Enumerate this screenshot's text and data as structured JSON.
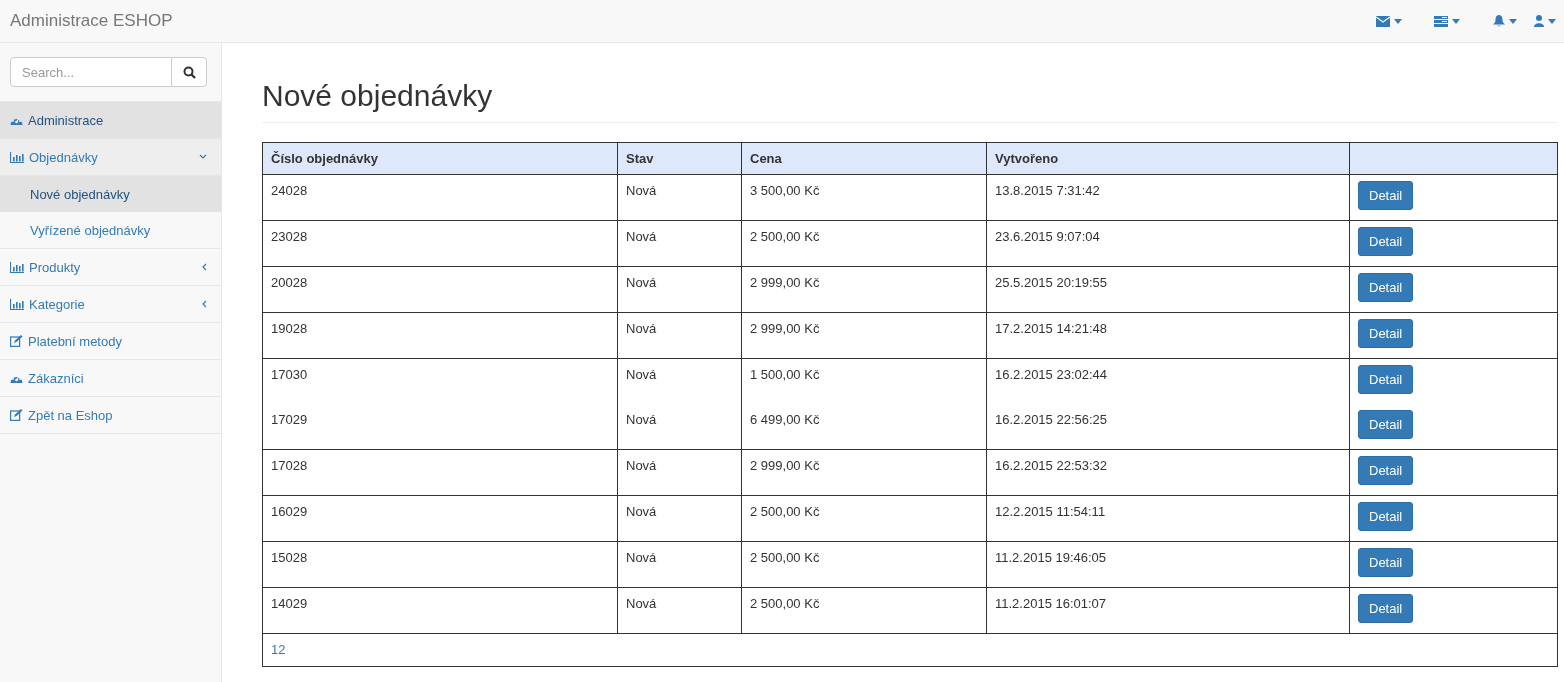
{
  "navbar": {
    "brand": "Administrace ESHOP",
    "icons": [
      {
        "kind": "envelope"
      },
      {
        "kind": "tasks"
      },
      {
        "kind": "bell"
      },
      {
        "kind": "user"
      }
    ]
  },
  "sidebar": {
    "search": {
      "placeholder": "Search..."
    },
    "items": [
      {
        "label": "Administrace",
        "kind": "dashboard",
        "selected": true
      },
      {
        "label": "Objednávky",
        "kind": "chart",
        "selected": false,
        "expanded": true,
        "children": [
          {
            "label": "Nové objednávky",
            "selected": true
          },
          {
            "label": "Vyřízené objednávky",
            "selected": false
          }
        ]
      },
      {
        "label": "Produkty",
        "kind": "chart",
        "selected": false,
        "expanded": false
      },
      {
        "label": "Kategorie",
        "kind": "chart",
        "selected": false,
        "expanded": false
      },
      {
        "label": "Platební metody",
        "kind": "edit",
        "selected": false
      },
      {
        "label": "Zákazníci",
        "kind": "dashboard",
        "selected": false
      },
      {
        "label": "Zpět na Eshop",
        "kind": "edit",
        "selected": false
      }
    ]
  },
  "page_title": "Nové objednávky",
  "table": {
    "columns": [
      "Číslo objednávky",
      "Stav",
      "Cena",
      "Vytvořeno"
    ],
    "rows": [
      {
        "cells": [
          "24028",
          "Nová",
          "3 500,00 Kč",
          "13.8.2015 7:31:42"
        ],
        "action": "Detail",
        "divided": true
      },
      {
        "cells": [
          "23028",
          "Nová",
          "2 500,00 Kč",
          "23.6.2015 9:07:04"
        ],
        "action": "Detail",
        "divided": true
      },
      {
        "cells": [
          "20028",
          "Nová",
          "2 999,00 Kč",
          "25.5.2015 20:19:55"
        ],
        "action": "Detail",
        "divided": true
      },
      {
        "cells": [
          "19028",
          "Nová",
          "2 999,00 Kč",
          "17.2.2015 14:21:48"
        ],
        "action": "Detail",
        "divided": true
      },
      {
        "cells": [
          "17030",
          "Nová",
          "1 500,00 Kč",
          "16.2.2015 23:02:44"
        ],
        "action": "Detail",
        "divided": true
      },
      {
        "cells": [
          "17029",
          "Nová",
          "6 499,00 Kč",
          "16.2.2015 22:56:25"
        ],
        "action": "Detail",
        "divided": false
      },
      {
        "cells": [
          "17028",
          "Nová",
          "2 999,00 Kč",
          "16.2.2015 22:53:32"
        ],
        "action": "Detail",
        "divided": true
      },
      {
        "cells": [
          "16029",
          "Nová",
          "2 500,00 Kč",
          "12.2.2015 11:54:11"
        ],
        "action": "Detail",
        "divided": true
      },
      {
        "cells": [
          "15028",
          "Nová",
          "2 500,00 Kč",
          "11.2.2015 19:46:05"
        ],
        "action": "Detail",
        "divided": true
      },
      {
        "cells": [
          "14029",
          "Nová",
          "2 500,00 Kč",
          "11.2.2015 16:01:07"
        ],
        "action": "Detail",
        "divided": true
      }
    ],
    "pages": [
      "1",
      "2"
    ]
  }
}
